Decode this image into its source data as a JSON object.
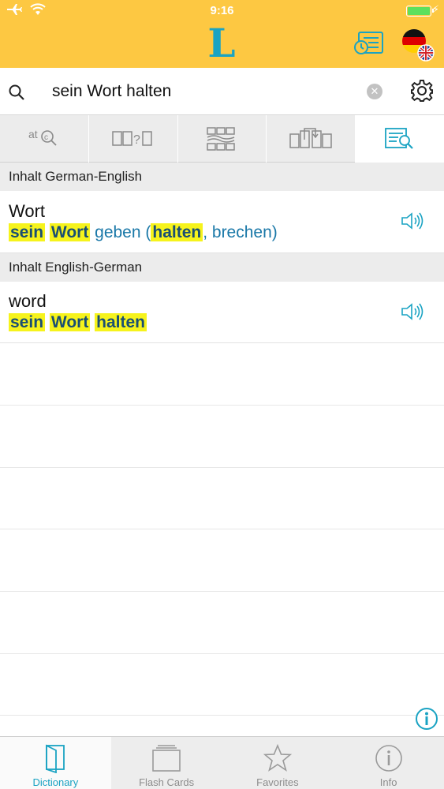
{
  "status": {
    "time": "9:16",
    "icons": [
      "airplane-icon",
      "wifi-icon",
      "battery-icon",
      "charging-icon"
    ]
  },
  "header": {
    "logo_text": "L",
    "history_icon": "history-icon",
    "language_icon": "flag-de-en-icon"
  },
  "search": {
    "value": "sein Wort halten",
    "placeholder": "",
    "search_icon": "search-icon",
    "clear_icon": "clear-icon",
    "settings_icon": "gear-icon"
  },
  "tool_tabs": [
    {
      "name": "ac-search-tab",
      "icon": "ac-search-icon"
    },
    {
      "name": "wildcard-search-tab",
      "icon": "wildcard-icon"
    },
    {
      "name": "word-puzzle-tab",
      "icon": "puzzle-icon"
    },
    {
      "name": "conjugation-tab",
      "icon": "conjugation-icon"
    },
    {
      "name": "fulltext-search-tab",
      "icon": "fulltext-search-icon",
      "active": true
    }
  ],
  "sections": [
    {
      "title": "Inhalt German-English",
      "entries": [
        {
          "headword": "Wort",
          "phrase_parts": [
            {
              "text": "sein",
              "highlight": true
            },
            {
              "text": " ",
              "highlight": false
            },
            {
              "text": "Wort",
              "highlight": true
            },
            {
              "text": " geben (",
              "highlight": false
            },
            {
              "text": "halten",
              "highlight": true
            },
            {
              "text": ", brechen)",
              "highlight": false
            }
          ]
        }
      ]
    },
    {
      "title": "Inhalt English-German",
      "entries": [
        {
          "headword": "word",
          "phrase_parts": [
            {
              "text": "sein",
              "highlight": true
            },
            {
              "text": " ",
              "highlight": false
            },
            {
              "text": "Wort",
              "highlight": true
            },
            {
              "text": " ",
              "highlight": false
            },
            {
              "text": "halten",
              "highlight": true
            }
          ]
        }
      ]
    }
  ],
  "bottom_tabs": [
    {
      "label": "Dictionary",
      "icon": "book-icon",
      "active": true
    },
    {
      "label": "Flash Cards",
      "icon": "flash-cards-icon",
      "active": false
    },
    {
      "label": "Favorites",
      "icon": "star-icon",
      "active": false
    },
    {
      "label": "Info",
      "icon": "info-icon",
      "active": false
    }
  ],
  "colors": {
    "accent": "#1aa3c3",
    "header": "#fdc842",
    "highlight": "#f6f31c",
    "link": "#1a78a8"
  }
}
